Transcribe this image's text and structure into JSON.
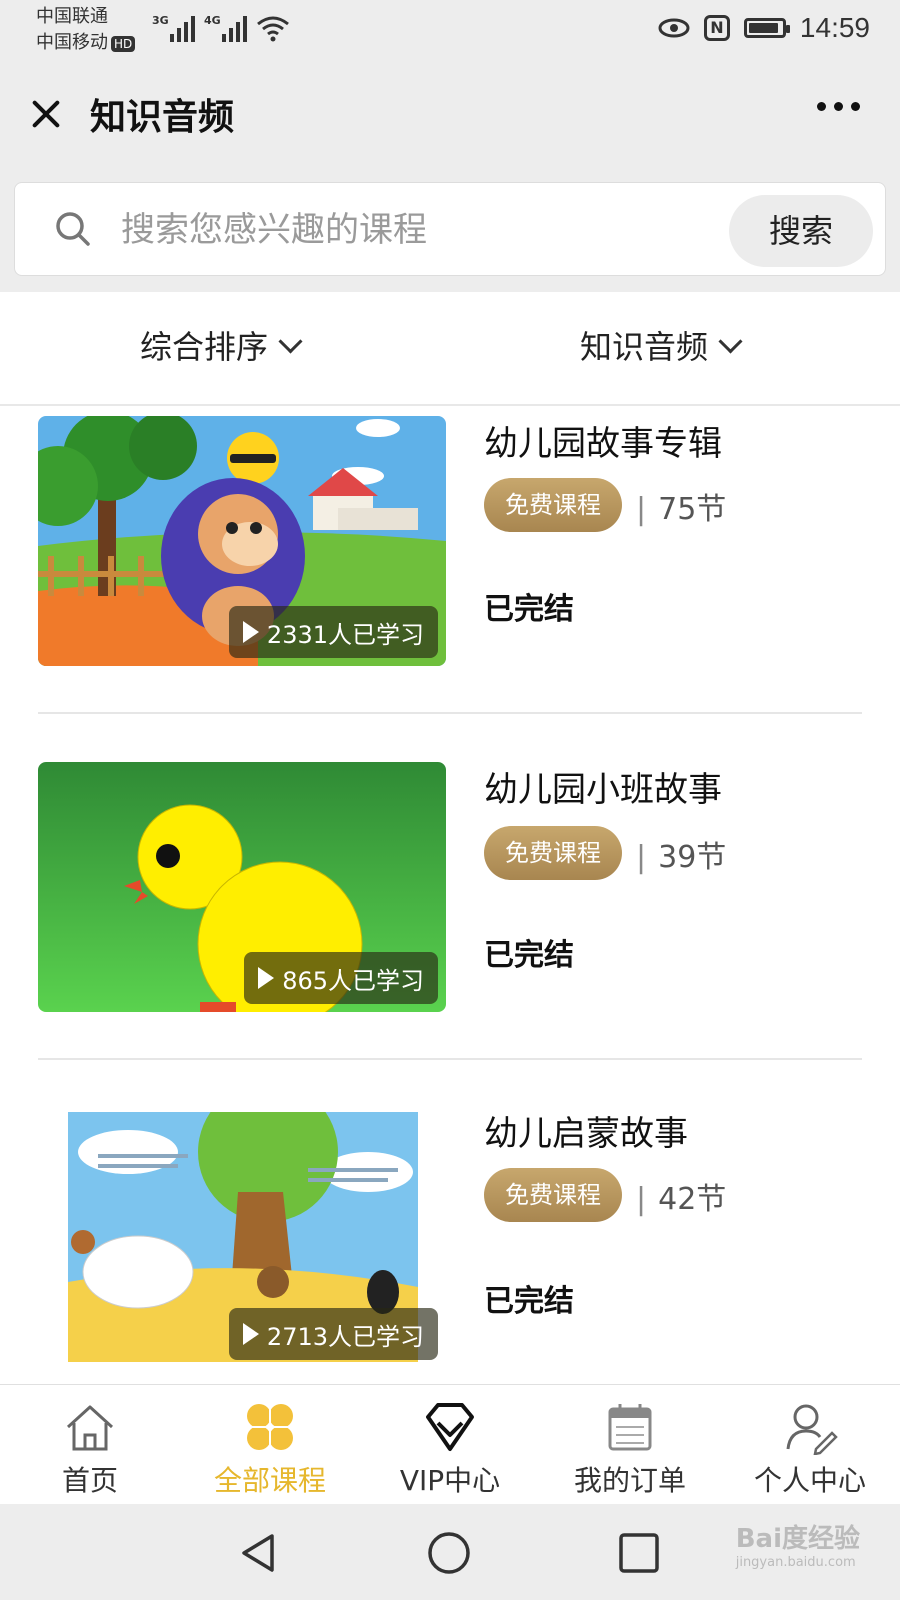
{
  "status_bar": {
    "carrier_1": "中国联通",
    "carrier_2": "中国移动",
    "hd": "HD",
    "net_1": "3G",
    "net_2": "4G",
    "battery_percent": 90,
    "time": "14:59"
  },
  "header": {
    "title": "知识音频"
  },
  "search": {
    "placeholder": "搜索您感兴趣的课程",
    "button_label": "搜索"
  },
  "filters": {
    "sort_label": "综合排序",
    "category_label": "知识音频"
  },
  "courses": [
    {
      "title": "幼儿园故事专辑",
      "badge": "免费课程",
      "lessons": "75节",
      "learners": "2331人已学习",
      "status": "已完结"
    },
    {
      "title": "幼儿园小班故事",
      "badge": "免费课程",
      "lessons": "39节",
      "learners": "865人已学习",
      "status": "已完结"
    },
    {
      "title": "幼儿启蒙故事",
      "badge": "免费课程",
      "lessons": "42节",
      "learners": "2713人已学习",
      "status": "已完结"
    }
  ],
  "tabbar": {
    "tabs": [
      {
        "label": "首页",
        "icon": "home-icon"
      },
      {
        "label": "全部课程",
        "icon": "clover-icon"
      },
      {
        "label": "VIP中心",
        "icon": "vip-diamond-icon"
      },
      {
        "label": "我的订单",
        "icon": "calendar-icon"
      },
      {
        "label": "个人中心",
        "icon": "user-edit-icon"
      }
    ],
    "active_color": "#e6b72d"
  },
  "watermark": {
    "brand": "Bai度经验",
    "url": "jingyan.baidu.com"
  }
}
